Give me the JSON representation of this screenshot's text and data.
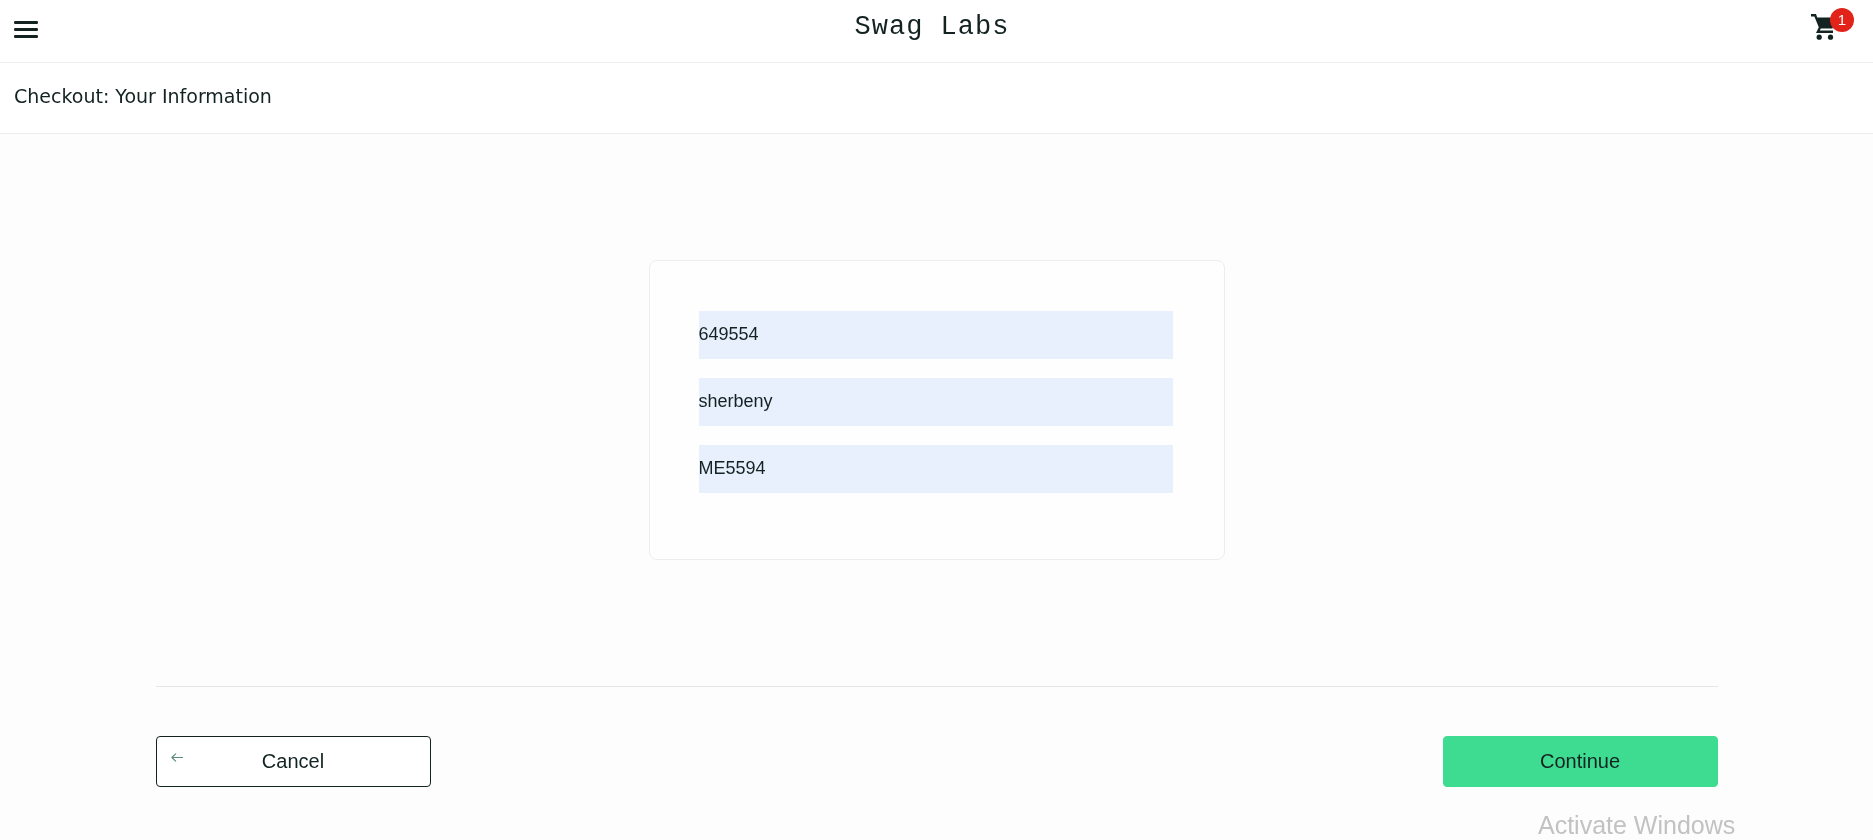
{
  "header": {
    "title": "Swag Labs",
    "cart_count": "1"
  },
  "subheader": {
    "title": "Checkout: Your Information"
  },
  "form": {
    "fields": [
      {
        "value": "649554",
        "autofilled": true
      },
      {
        "value": "sherbeny",
        "autofilled": true
      },
      {
        "value": "ME5594",
        "autofilled": true
      }
    ]
  },
  "actions": [
    {
      "label": "Cancel",
      "kind": "secondary"
    },
    {
      "label": "Continue",
      "kind": "primary"
    }
  ],
  "system_overlay": {
    "text": "Activate Windows"
  }
}
